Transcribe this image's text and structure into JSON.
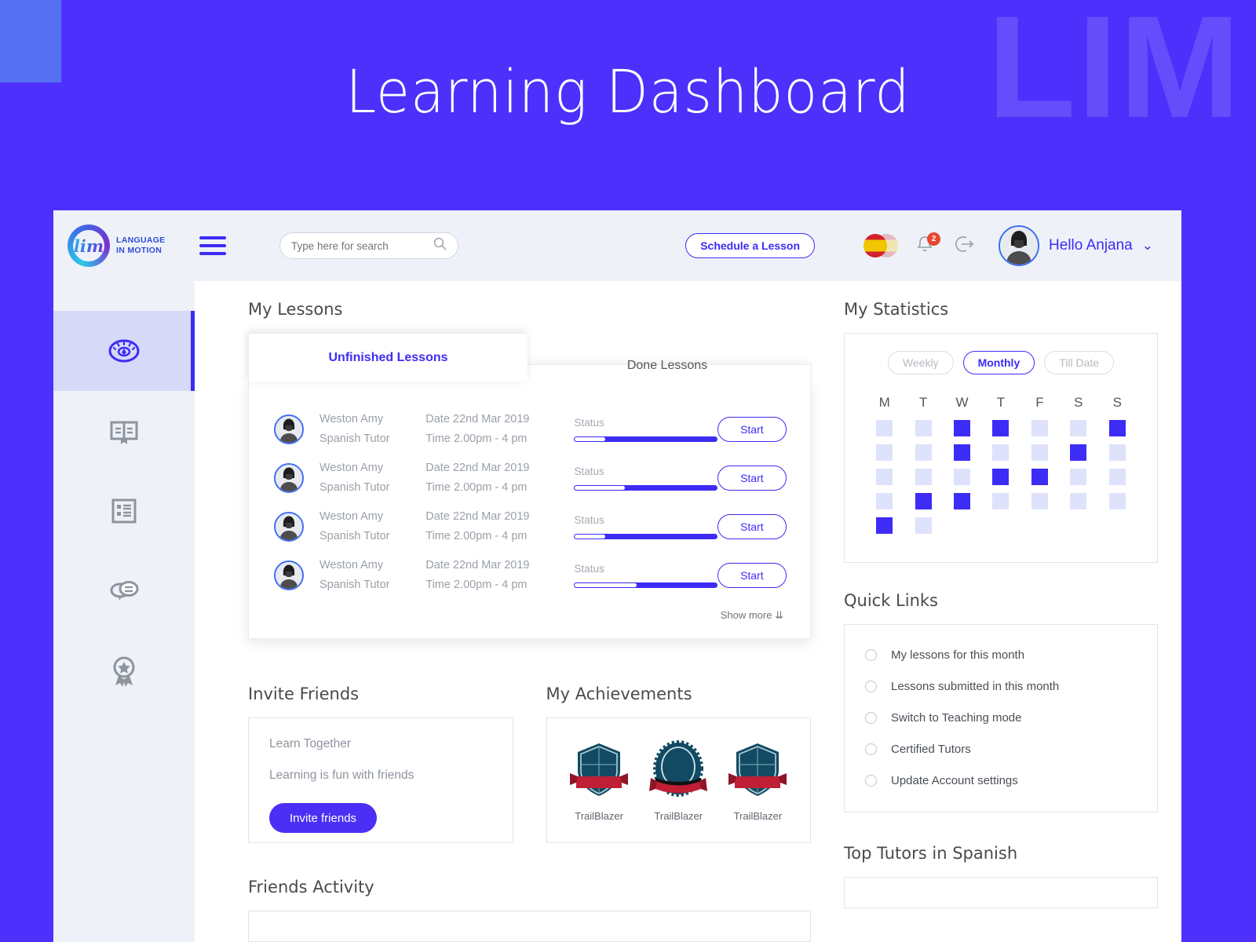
{
  "poster": {
    "title": "Learning Dashboard",
    "watermark": "LIM",
    "bg_color": "#4d30fb",
    "accent_color": "#5670f2"
  },
  "brand": {
    "mark_text": "lim",
    "line1": "LANGUAGE",
    "line2": "IN MOTION"
  },
  "sidebar": {
    "items": [
      {
        "name": "dashboard",
        "icon": "speedometer-icon",
        "active": true
      },
      {
        "name": "courses",
        "icon": "book-icon",
        "active": false
      },
      {
        "name": "assignments",
        "icon": "checklist-icon",
        "active": false
      },
      {
        "name": "messages",
        "icon": "chat-icon",
        "active": false
      },
      {
        "name": "achievements",
        "icon": "award-icon",
        "active": false
      }
    ]
  },
  "topbar": {
    "menu_icon": "hamburger-icon",
    "search": {
      "placeholder": "Type here for search",
      "value": "",
      "icon": "search-icon"
    },
    "schedule_label": "Schedule a Lesson",
    "language_flag": "spain-flag-icon",
    "notifications": {
      "icon": "bell-icon",
      "count": "2"
    },
    "logout_icon": "logout-icon",
    "user": {
      "greeting": "Hello Anjana",
      "caret": "chevron-down-icon"
    }
  },
  "lessons": {
    "section_title": "My Lessons",
    "tabs": [
      {
        "label": "Unfinished Lessons",
        "active": true
      },
      {
        "label": "Done Lessons",
        "active": false
      }
    ],
    "status_label": "Status",
    "start_label": "Start",
    "show_more": "Show more",
    "rows": [
      {
        "name": "Weston Amy",
        "role": "Spanish Tutor",
        "date": "Date 22nd Mar 2019",
        "time": "Time 2.00pm - 4 pm",
        "status": "Status",
        "progress": 78,
        "action": "Start"
      },
      {
        "name": "Weston Amy",
        "role": "Spanish Tutor",
        "date": "Date 22nd Mar 2019",
        "time": "Time 2.00pm - 4 pm",
        "status": "Status",
        "progress": 64,
        "action": "Start"
      },
      {
        "name": "Weston Amy",
        "role": "Spanish Tutor",
        "date": "Date 22nd Mar 2019",
        "time": "Time 2.00pm - 4 pm",
        "status": "Status",
        "progress": 78,
        "action": "Start"
      },
      {
        "name": "Weston Amy",
        "role": "Spanish Tutor",
        "date": "Date 22nd Mar 2019",
        "time": "Time 2.00pm - 4 pm",
        "status": "Status",
        "progress": 56,
        "action": "Start"
      }
    ]
  },
  "invite": {
    "section_title": "Invite Friends",
    "heading": "Learn Together",
    "subheading": "Learning is fun with friends",
    "button_label": "Invite friends"
  },
  "achievements": {
    "section_title": "My Achievements",
    "items": [
      {
        "label": "TrailBlazer",
        "icon": "shield-badge-icon"
      },
      {
        "label": "TrailBlazer",
        "icon": "rosette-badge-icon"
      },
      {
        "label": "TrailBlazer",
        "icon": "shield-badge-icon"
      }
    ]
  },
  "statistics": {
    "section_title": "My Statistics",
    "range_options": [
      {
        "label": "Weekly",
        "active": false
      },
      {
        "label": "Monthly",
        "active": true
      },
      {
        "label": "Till Date",
        "active": false
      }
    ],
    "day_headers": [
      "M",
      "T",
      "W",
      "T",
      "F",
      "S",
      "S"
    ],
    "grid": [
      [
        0,
        0,
        1,
        1,
        0,
        0,
        1
      ],
      [
        0,
        0,
        1,
        0,
        0,
        1,
        0
      ],
      [
        0,
        0,
        0,
        1,
        1,
        0,
        0
      ],
      [
        0,
        1,
        1,
        0,
        0,
        0,
        0
      ],
      [
        1,
        0,
        -1,
        -1,
        -1,
        -1,
        -1
      ]
    ]
  },
  "quick_links": {
    "section_title": "Quick Links",
    "items": [
      "My lessons for this month",
      "Lessons submitted in this month",
      "Switch to Teaching mode",
      "Certified Tutors",
      "Update Account settings"
    ]
  },
  "bottom": {
    "friends_activity_title": "Friends Activity",
    "top_tutors_title": "Top Tutors in Spanish"
  }
}
